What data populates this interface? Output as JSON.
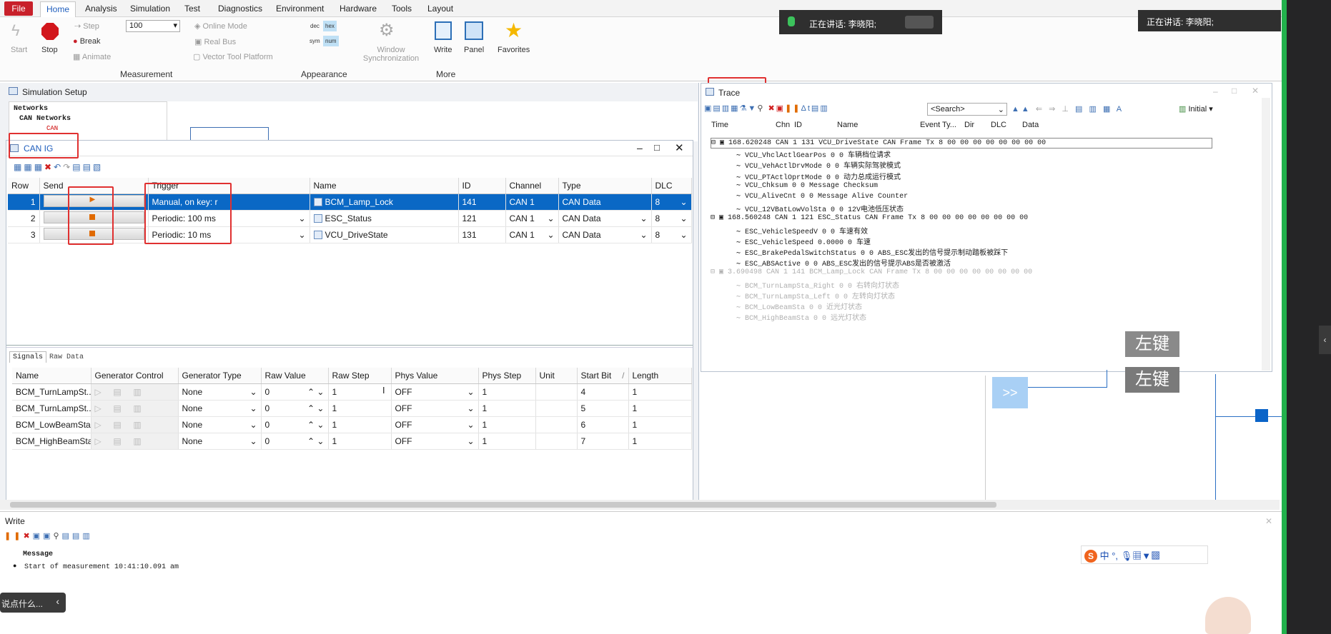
{
  "ribbon": {
    "tabs": [
      "File",
      "Home",
      "Analysis",
      "Simulation",
      "Test",
      "Diagnostics",
      "Environment",
      "Hardware",
      "Tools",
      "Layout"
    ],
    "start": "Start",
    "stop": "Stop",
    "step": "Step",
    "break": "Break",
    "animate": "Animate",
    "speed": "100",
    "online_mode": "Online Mode",
    "real_bus": "Real Bus",
    "vector_tool_platform": "Vector Tool Platform",
    "dec": "dec",
    "hex": "hex",
    "sym": "sym",
    "num": "num",
    "window_sync": "Window Synchronization",
    "write": "Write",
    "panel": "Panel",
    "favorites": "Favorites",
    "group_measurement": "Measurement",
    "group_appearance": "Appearance",
    "group_more": "More"
  },
  "speaking": {
    "left": "正在讲话: 李晓阳;",
    "right": "正在讲话: 李晓阳;"
  },
  "simsetup": {
    "title": "Simulation Setup",
    "tree": [
      "Networks",
      "CAN Networks",
      "CAN"
    ]
  },
  "canig": {
    "title": "CAN IG",
    "cols": [
      "Row",
      "Send",
      "Trigger",
      "Name",
      "ID",
      "Channel",
      "Type",
      "DLC"
    ],
    "rows": [
      {
        "row": "1",
        "trigger": "Manual, on key: r",
        "name": "BCM_Lamp_Lock",
        "id": "141",
        "channel": "CAN 1",
        "type": "CAN Data",
        "dlc": "8"
      },
      {
        "row": "2",
        "trigger": "Periodic: 100 ms",
        "name": "ESC_Status",
        "id": "121",
        "channel": "CAN 1",
        "type": "CAN Data",
        "dlc": "8"
      },
      {
        "row": "3",
        "trigger": "Periodic: 10 ms",
        "name": "VCU_DriveState",
        "id": "131",
        "channel": "CAN 1",
        "type": "CAN Data",
        "dlc": "8"
      }
    ],
    "tabs": [
      "Signals",
      "Raw Data"
    ],
    "sig_cols": [
      "Name",
      "Generator Control",
      "Generator Type",
      "Raw Value",
      "Raw Step",
      "Phys Value",
      "Phys Step",
      "Unit",
      "Start Bit",
      "Length"
    ],
    "sig_rows": [
      {
        "name": "BCM_TurnLampSt...",
        "gtype": "None",
        "raw": "0",
        "rstep": "1",
        "phys": "OFF",
        "pstep": "1",
        "unit": "",
        "start": "4",
        "len": "1"
      },
      {
        "name": "BCM_TurnLampSt...",
        "gtype": "None",
        "raw": "0",
        "rstep": "1",
        "phys": "OFF",
        "pstep": "1",
        "unit": "",
        "start": "5",
        "len": "1"
      },
      {
        "name": "BCM_LowBeamSta",
        "gtype": "None",
        "raw": "0",
        "rstep": "1",
        "phys": "OFF",
        "pstep": "1",
        "unit": "",
        "start": "6",
        "len": "1"
      },
      {
        "name": "BCM_HighBeamSta",
        "gtype": "None",
        "raw": "0",
        "rstep": "1",
        "phys": "OFF",
        "pstep": "1",
        "unit": "",
        "start": "7",
        "len": "1"
      }
    ]
  },
  "trace": {
    "title": "Trace",
    "search": "<Search>",
    "initial": "Initial",
    "cols": [
      "Time",
      "Chn",
      "ID",
      "Name",
      "Event Ty...",
      "Dir",
      "DLC",
      "Data"
    ],
    "rows": [
      {
        "text": "168.620248 CAN 1 131   VCU_DriveState     CAN Frame  Tx   8     00 00 00 00 00 00 00 00",
        "kind": "msg"
      },
      {
        "text": "VCU_VhclActlGearPos              0        0 车辆档位请求",
        "kind": "sig"
      },
      {
        "text": "VCU_VehActlDrvMode               0        0 车辆实际驾驶模式",
        "kind": "sig"
      },
      {
        "text": "VCU_PTActlOprtMode               0        0 动力总成运行模式",
        "kind": "sig"
      },
      {
        "text": "VCU_Chksum                       0        0 Message Checksum",
        "kind": "sig"
      },
      {
        "text": "VCU_AliveCnt                     0        0 Message Alive Counter",
        "kind": "sig"
      },
      {
        "text": "VCU_12VBatLowVolSta              0        0 12V电池低压状态",
        "kind": "sig"
      },
      {
        "text": "168.560248 CAN 1 121    ESC_Status        CAN Frame  Tx   8     00 00 00 00 00 00 00 00",
        "kind": "msg"
      },
      {
        "text": "ESC_VehicleSpeedV                0        0 车速有效",
        "kind": "sig"
      },
      {
        "text": "ESC_VehicleSpeed            0.0000        0 车速",
        "kind": "sig"
      },
      {
        "text": "ESC_BrakePedalSwitchStatus       0        0 ABS_ESC发出的信号提示制动踏板被踩下",
        "kind": "sig"
      },
      {
        "text": "ESC_ABSActive                    0        0 ABS_ESC发出的信号提示ABS是否被激活",
        "kind": "sig"
      },
      {
        "text": "3.690498  CAN 1 141   BCM_Lamp_Lock      CAN Frame  Tx   8     00 00 00 00 00 00 00 00",
        "kind": "msgdim"
      },
      {
        "text": "BCM_TurnLampSta_Right            0        0 右转向灯状态",
        "kind": "sigdim"
      },
      {
        "text": "BCM_TurnLampSta_Left             0        0 左转向灯状态",
        "kind": "sigdim"
      },
      {
        "text": "BCM_LowBeamSta                   0        0 近光灯状态",
        "kind": "sigdim"
      },
      {
        "text": "BCM_HighBeamSta                  0        0 远光灯状态",
        "kind": "sigdim"
      }
    ]
  },
  "overlay": {
    "key1": "左键",
    "key2": "左键",
    "expand": ">>"
  },
  "write": {
    "title": "Write",
    "col": "Message",
    "line": "Start of measurement 10:41:10.091 am"
  },
  "chat": {
    "placeholder": "说点什么..."
  },
  "ime": {
    "chars": "中 °,"
  }
}
